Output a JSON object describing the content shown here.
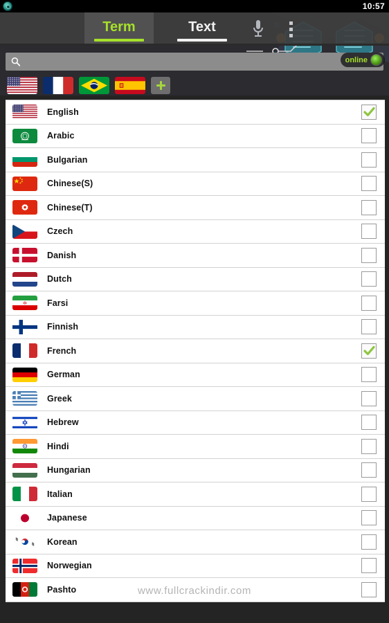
{
  "statusbar": {
    "clock": "10:57",
    "app_icon": "app-circle-icon"
  },
  "tabs": [
    {
      "label": "Term",
      "active": true,
      "accent": "#a6e02a"
    },
    {
      "label": "Text",
      "active": false,
      "accent": "#f2f2f2"
    }
  ],
  "toolbar": {
    "mic_icon": "microphone-icon",
    "overflow_icon": "overflow-menu-icon"
  },
  "search": {
    "value": "",
    "placeholder": "",
    "icon": "search-icon"
  },
  "status_badge": {
    "label": "online",
    "color": "#a6e02a",
    "led_icon": "online-led-icon"
  },
  "selected_flags": [
    {
      "name": "United States",
      "code": "us"
    },
    {
      "name": "France",
      "code": "fr"
    },
    {
      "name": "Brazil",
      "code": "br"
    },
    {
      "name": "Spain",
      "code": "es"
    }
  ],
  "add_button": {
    "label": "+",
    "icon": "plus-icon"
  },
  "languages": [
    {
      "label": "English",
      "code": "us",
      "checked": true
    },
    {
      "label": "Arabic",
      "code": "ar",
      "checked": false
    },
    {
      "label": "Bulgarian",
      "code": "bg",
      "checked": false
    },
    {
      "label": "Chinese(S)",
      "code": "cn",
      "checked": false
    },
    {
      "label": "Chinese(T)",
      "code": "hk",
      "checked": false
    },
    {
      "label": "Czech",
      "code": "cz",
      "checked": false
    },
    {
      "label": "Danish",
      "code": "dk",
      "checked": false
    },
    {
      "label": "Dutch",
      "code": "nl",
      "checked": false
    },
    {
      "label": "Farsi",
      "code": "ir",
      "checked": false
    },
    {
      "label": "Finnish",
      "code": "fi",
      "checked": false
    },
    {
      "label": "French",
      "code": "fr",
      "checked": true
    },
    {
      "label": "German",
      "code": "de",
      "checked": false
    },
    {
      "label": "Greek",
      "code": "gr",
      "checked": false
    },
    {
      "label": "Hebrew",
      "code": "il",
      "checked": false
    },
    {
      "label": "Hindi",
      "code": "in",
      "checked": false
    },
    {
      "label": "Hungarian",
      "code": "hu",
      "checked": false
    },
    {
      "label": "Italian",
      "code": "it",
      "checked": false
    },
    {
      "label": "Japanese",
      "code": "jp",
      "checked": false
    },
    {
      "label": "Korean",
      "code": "kr",
      "checked": false
    },
    {
      "label": "Norwegian",
      "code": "no",
      "checked": false
    },
    {
      "label": "Pashto",
      "code": "af",
      "checked": false
    }
  ],
  "watermark": "www.fullcrackindir.com"
}
